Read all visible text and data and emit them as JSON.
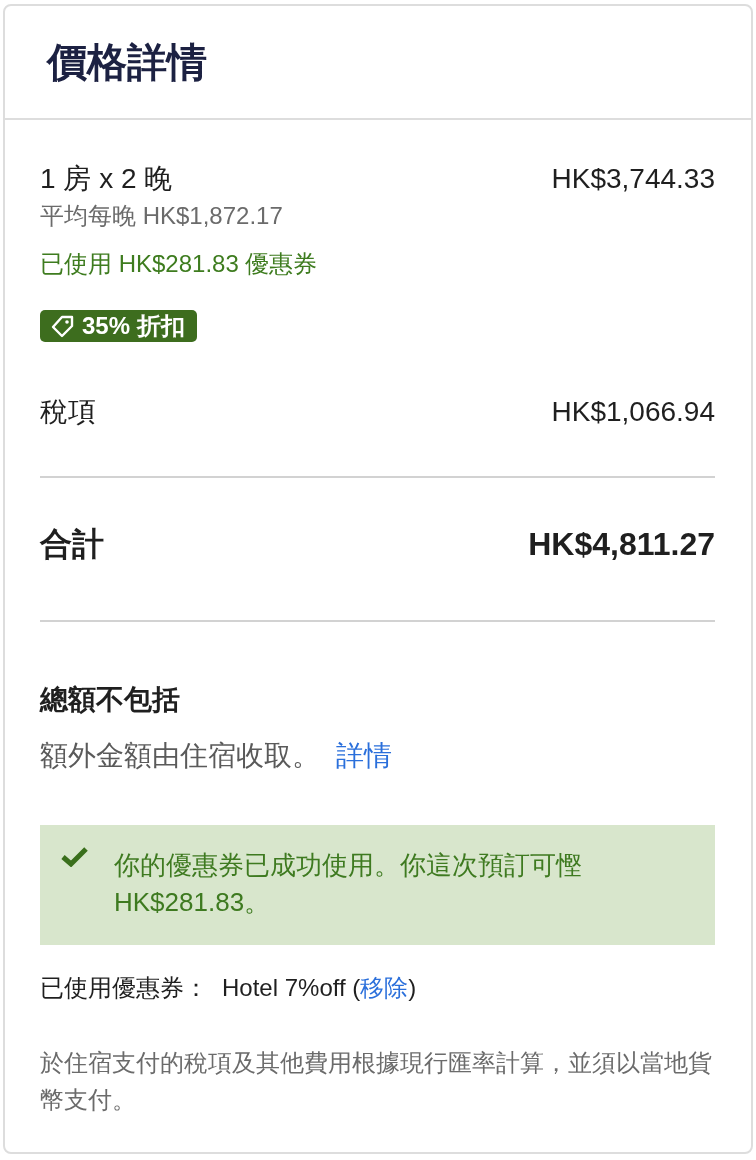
{
  "header": {
    "title": "價格詳情"
  },
  "room": {
    "label": "1 房 x 2 晚",
    "amount": "HK$3,744.33",
    "average": "平均每晚 HK$1,872.17",
    "coupon_note": "已使用 HK$281.83 優惠券",
    "badge": "35% 折扣"
  },
  "taxes": {
    "label": "稅項",
    "amount": "HK$1,066.94"
  },
  "total": {
    "label": "合計",
    "amount": "HK$4,811.27"
  },
  "not_included": {
    "heading": "總額不包括",
    "text": "額外金額由住宿收取。",
    "link": "詳情"
  },
  "success_alert": {
    "message": "你的優惠券已成功使用。你這次預訂可慳 HK$281.83。"
  },
  "applied_coupon": {
    "label": "已使用優惠券：",
    "code": "Hotel 7%off",
    "open": "(",
    "remove_link": "移除",
    "close": ")"
  },
  "footnote": "於住宿支付的稅項及其他費用根據現行匯率計算，並須以當地貨幣支付。"
}
